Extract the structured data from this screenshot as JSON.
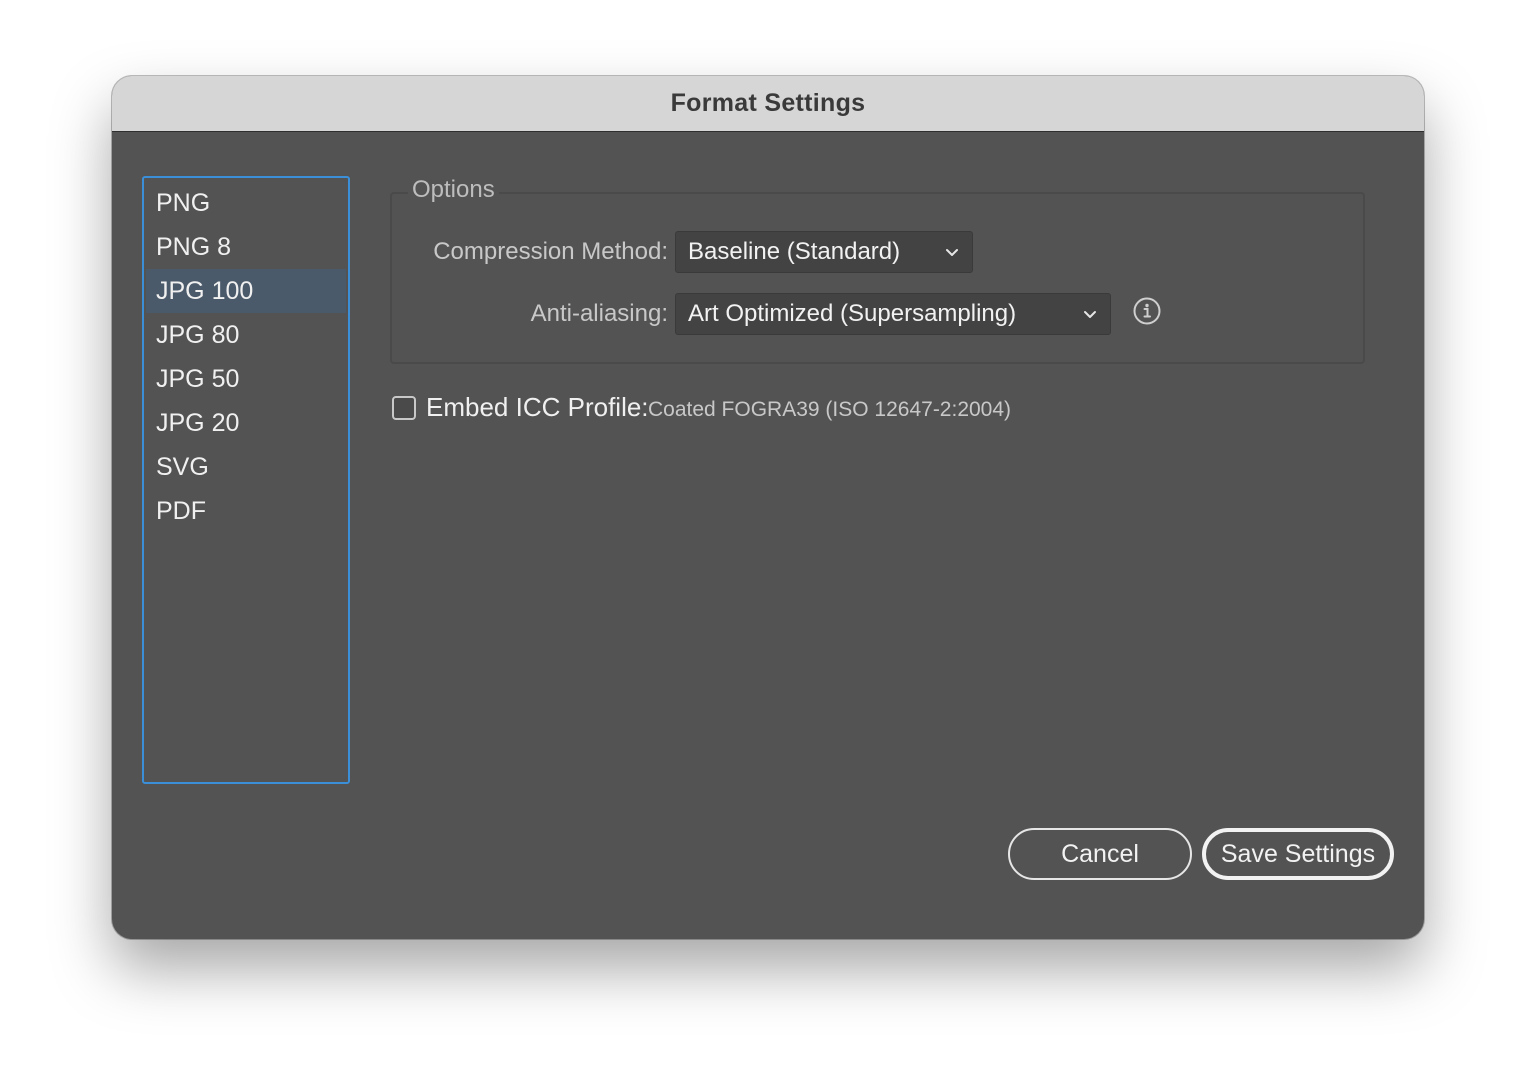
{
  "window": {
    "title": "Format Settings"
  },
  "formats": {
    "items": [
      "PNG",
      "PNG 8",
      "JPG 100",
      "JPG 80",
      "JPG 50",
      "JPG 20",
      "SVG",
      "PDF"
    ],
    "selected": "JPG 100"
  },
  "options": {
    "legend": "Options",
    "compression": {
      "label": "Compression Method:",
      "value": "Baseline (Standard)"
    },
    "antialiasing": {
      "label": "Anti-aliasing:",
      "value": "Art Optimized (Supersampling)"
    }
  },
  "embed_icc": {
    "checked": false,
    "label": "Embed ICC Profile:",
    "profile": "Coated FOGRA39 (ISO 12647-2:2004)"
  },
  "buttons": {
    "cancel": "Cancel",
    "save": "Save Settings"
  },
  "icons": {
    "info": "info-icon",
    "chevron": "chevron-down-icon"
  },
  "colors": {
    "accent": "#3b8ed8",
    "selection": "#4b5a6b",
    "panel": "#535353",
    "titlebar": "#d6d6d6"
  }
}
